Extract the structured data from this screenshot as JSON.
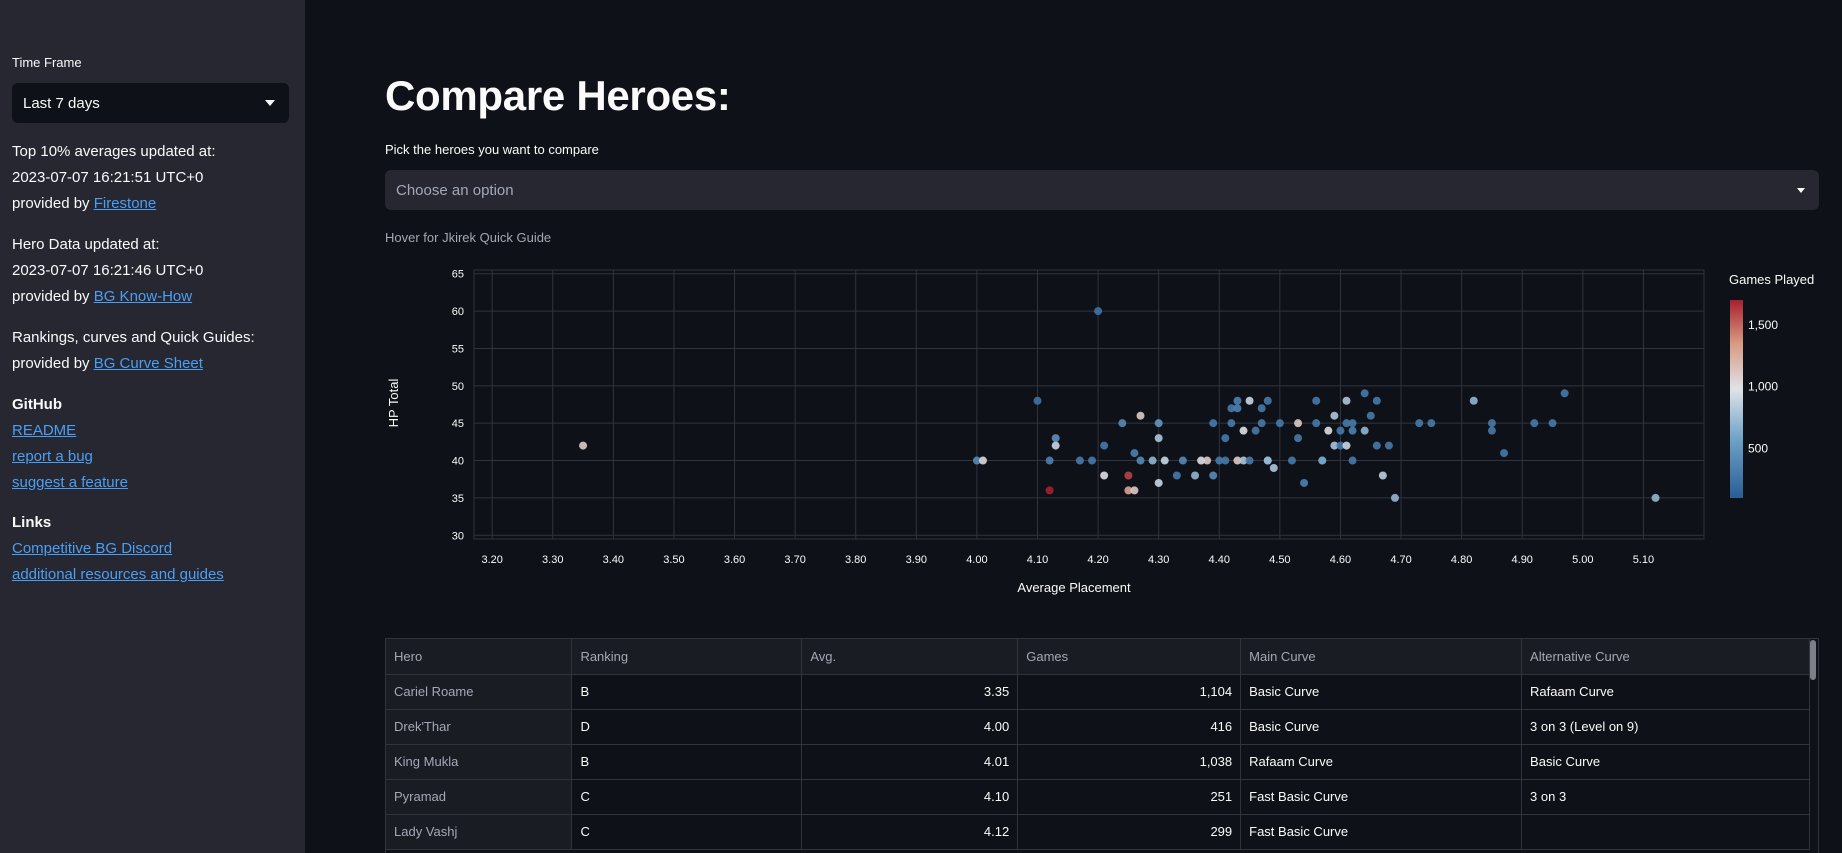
{
  "sidebar": {
    "timeframe_label": "Time Frame",
    "timeframe_value": "Last 7 days",
    "top10_line1": "Top 10% averages updated at:",
    "top10_line2": "2023-07-07 16:21:51 UTC+0",
    "top10_prefix": "provided by ",
    "top10_link": "Firestone",
    "hero_line1": "Hero Data updated at:",
    "hero_line2": "2023-07-07 16:21:46 UTC+0",
    "hero_prefix": "provided by ",
    "hero_link": "BG Know-How",
    "rank_line1": "Rankings, curves and Quick Guides:",
    "rank_prefix": "provided by ",
    "rank_link": "BG Curve Sheet",
    "github_head": "GitHub",
    "github_links": [
      "README",
      "report a bug",
      "suggest a feature"
    ],
    "links_head": "Links",
    "links": [
      "Competitive BG Discord",
      "additional resources and guides"
    ]
  },
  "main": {
    "title": "Compare Heroes:",
    "pick_label": "Pick the heroes you want to compare",
    "pick_placeholder": "Choose an option",
    "hover_label": "Hover for Jkirek Quick Guide"
  },
  "chart_data": {
    "type": "scatter",
    "xlabel": "Average Placement",
    "ylabel": "HP Total",
    "xlim": [
      3.17,
      5.2
    ],
    "ylim": [
      29.5,
      65.5
    ],
    "xticks": [
      "3.20",
      "3.30",
      "3.40",
      "3.50",
      "3.60",
      "3.70",
      "3.80",
      "3.90",
      "4.00",
      "4.10",
      "4.20",
      "4.30",
      "4.40",
      "4.50",
      "4.60",
      "4.70",
      "4.80",
      "4.90",
      "5.00",
      "5.10"
    ],
    "yticks": [
      "30",
      "35",
      "40",
      "45",
      "50",
      "55",
      "60",
      "65"
    ],
    "colorbar": {
      "title": "Games Played",
      "ticks": [
        "1,500",
        "1,000",
        "500"
      ],
      "min": 100,
      "max": 1700,
      "colors": [
        "#2a5d95",
        "#6fa3c8",
        "#dfe3e8",
        "#d99a82",
        "#a8202f"
      ]
    },
    "points": [
      {
        "x": 3.35,
        "y": 42,
        "g": 1104
      },
      {
        "x": 4.0,
        "y": 40,
        "g": 416
      },
      {
        "x": 4.01,
        "y": 40,
        "g": 1038
      },
      {
        "x": 4.1,
        "y": 48,
        "g": 251
      },
      {
        "x": 4.12,
        "y": 36,
        "g": 1700
      },
      {
        "x": 4.12,
        "y": 40,
        "g": 350
      },
      {
        "x": 4.13,
        "y": 43,
        "g": 450
      },
      {
        "x": 4.13,
        "y": 42,
        "g": 900
      },
      {
        "x": 4.17,
        "y": 40,
        "g": 300
      },
      {
        "x": 4.19,
        "y": 40,
        "g": 300
      },
      {
        "x": 4.2,
        "y": 60,
        "g": 250
      },
      {
        "x": 4.21,
        "y": 42,
        "g": 300
      },
      {
        "x": 4.21,
        "y": 38,
        "g": 1000
      },
      {
        "x": 4.24,
        "y": 45,
        "g": 400
      },
      {
        "x": 4.25,
        "y": 38,
        "g": 1600
      },
      {
        "x": 4.25,
        "y": 36,
        "g": 1300
      },
      {
        "x": 4.26,
        "y": 36,
        "g": 1100
      },
      {
        "x": 4.26,
        "y": 41,
        "g": 350
      },
      {
        "x": 4.27,
        "y": 40,
        "g": 400
      },
      {
        "x": 4.27,
        "y": 46,
        "g": 1100
      },
      {
        "x": 4.29,
        "y": 40,
        "g": 700
      },
      {
        "x": 4.3,
        "y": 45,
        "g": 500
      },
      {
        "x": 4.3,
        "y": 43,
        "g": 800
      },
      {
        "x": 4.3,
        "y": 37,
        "g": 900
      },
      {
        "x": 4.31,
        "y": 40,
        "g": 900
      },
      {
        "x": 4.33,
        "y": 38,
        "g": 300
      },
      {
        "x": 4.34,
        "y": 40,
        "g": 400
      },
      {
        "x": 4.36,
        "y": 38,
        "g": 700
      },
      {
        "x": 4.37,
        "y": 40,
        "g": 1000
      },
      {
        "x": 4.38,
        "y": 40,
        "g": 1100
      },
      {
        "x": 4.39,
        "y": 38,
        "g": 400
      },
      {
        "x": 4.39,
        "y": 45,
        "g": 300
      },
      {
        "x": 4.4,
        "y": 40,
        "g": 300
      },
      {
        "x": 4.41,
        "y": 40,
        "g": 300
      },
      {
        "x": 4.41,
        "y": 43,
        "g": 300
      },
      {
        "x": 4.42,
        "y": 45,
        "g": 300
      },
      {
        "x": 4.42,
        "y": 47,
        "g": 300
      },
      {
        "x": 4.43,
        "y": 47,
        "g": 350
      },
      {
        "x": 4.43,
        "y": 40,
        "g": 1100
      },
      {
        "x": 4.43,
        "y": 48,
        "g": 350
      },
      {
        "x": 4.44,
        "y": 44,
        "g": 1000
      },
      {
        "x": 4.44,
        "y": 40,
        "g": 800
      },
      {
        "x": 4.45,
        "y": 48,
        "g": 900
      },
      {
        "x": 4.45,
        "y": 40,
        "g": 300
      },
      {
        "x": 4.46,
        "y": 44,
        "g": 300
      },
      {
        "x": 4.47,
        "y": 45,
        "g": 300
      },
      {
        "x": 4.47,
        "y": 47,
        "g": 300
      },
      {
        "x": 4.48,
        "y": 40,
        "g": 850
      },
      {
        "x": 4.48,
        "y": 48,
        "g": 300
      },
      {
        "x": 4.48,
        "y": 40,
        "g": 700
      },
      {
        "x": 4.49,
        "y": 39,
        "g": 800
      },
      {
        "x": 4.5,
        "y": 45,
        "g": 300
      },
      {
        "x": 4.52,
        "y": 40,
        "g": 300
      },
      {
        "x": 4.53,
        "y": 43,
        "g": 300
      },
      {
        "x": 4.53,
        "y": 45,
        "g": 1100
      },
      {
        "x": 4.54,
        "y": 37,
        "g": 350
      },
      {
        "x": 4.56,
        "y": 45,
        "g": 300
      },
      {
        "x": 4.56,
        "y": 48,
        "g": 300
      },
      {
        "x": 4.57,
        "y": 40,
        "g": 400
      },
      {
        "x": 4.57,
        "y": 40,
        "g": 600
      },
      {
        "x": 4.58,
        "y": 44,
        "g": 1000
      },
      {
        "x": 4.59,
        "y": 42,
        "g": 800
      },
      {
        "x": 4.59,
        "y": 46,
        "g": 800
      },
      {
        "x": 4.6,
        "y": 44,
        "g": 300
      },
      {
        "x": 4.6,
        "y": 42,
        "g": 300
      },
      {
        "x": 4.61,
        "y": 45,
        "g": 300
      },
      {
        "x": 4.61,
        "y": 48,
        "g": 800
      },
      {
        "x": 4.61,
        "y": 42,
        "g": 900
      },
      {
        "x": 4.62,
        "y": 45,
        "g": 300
      },
      {
        "x": 4.62,
        "y": 44,
        "g": 350
      },
      {
        "x": 4.62,
        "y": 40,
        "g": 300
      },
      {
        "x": 4.64,
        "y": 49,
        "g": 300
      },
      {
        "x": 4.64,
        "y": 44,
        "g": 700
      },
      {
        "x": 4.65,
        "y": 46,
        "g": 300
      },
      {
        "x": 4.66,
        "y": 42,
        "g": 300
      },
      {
        "x": 4.66,
        "y": 48,
        "g": 300
      },
      {
        "x": 4.67,
        "y": 38,
        "g": 850
      },
      {
        "x": 4.68,
        "y": 42,
        "g": 300
      },
      {
        "x": 4.69,
        "y": 35,
        "g": 700
      },
      {
        "x": 4.73,
        "y": 45,
        "g": 300
      },
      {
        "x": 4.75,
        "y": 45,
        "g": 300
      },
      {
        "x": 4.82,
        "y": 48,
        "g": 700
      },
      {
        "x": 4.85,
        "y": 45,
        "g": 300
      },
      {
        "x": 4.85,
        "y": 44,
        "g": 300
      },
      {
        "x": 4.87,
        "y": 41,
        "g": 300
      },
      {
        "x": 4.92,
        "y": 45,
        "g": 300
      },
      {
        "x": 4.95,
        "y": 45,
        "g": 300
      },
      {
        "x": 4.97,
        "y": 49,
        "g": 300
      },
      {
        "x": 5.12,
        "y": 35,
        "g": 700
      }
    ]
  },
  "table": {
    "headers": [
      "Hero",
      "Ranking",
      "Avg.",
      "Games",
      "Main Curve",
      "Alternative Curve"
    ],
    "rows": [
      [
        "Cariel Roame",
        "B",
        "3.35",
        "1,104",
        "Basic Curve",
        "Rafaam Curve"
      ],
      [
        "Drek'Thar",
        "D",
        "4.00",
        "416",
        "Basic Curve",
        "3 on 3 (Level on 9)"
      ],
      [
        "King Mukla",
        "B",
        "4.01",
        "1,038",
        "Rafaam Curve",
        "Basic Curve"
      ],
      [
        "Pyramad",
        "C",
        "4.10",
        "251",
        "Fast Basic Curve",
        "3 on 3"
      ],
      [
        "Lady Vashj",
        "C",
        "4.12",
        "299",
        "Fast Basic Curve",
        ""
      ]
    ]
  }
}
